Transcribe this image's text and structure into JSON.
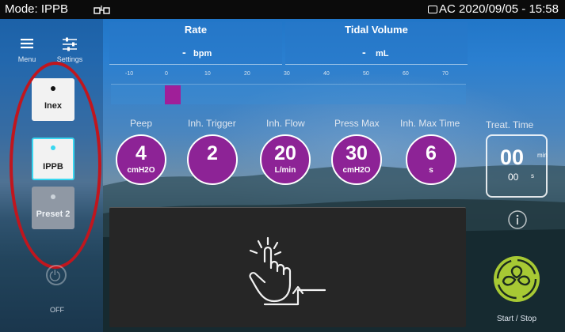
{
  "status_bar": {
    "mode": "Mode: IPPB",
    "datetime": "AC 2020/09/05 - 15:58"
  },
  "left_rail": {
    "menu_label": "Menu",
    "settings_label": "Settings",
    "modes": [
      {
        "label": "Inex",
        "selected": false
      },
      {
        "label": "IPPB",
        "selected": true
      },
      {
        "label": "Preset 2",
        "selected": false
      }
    ],
    "off_label": "OFF"
  },
  "readouts": {
    "rate": {
      "title": "Rate",
      "value": "-",
      "unit": "bpm"
    },
    "tidal_volume": {
      "title": "Tidal Volume",
      "value": "-",
      "unit": "mL"
    }
  },
  "pressure_bar": {
    "scale": [
      "-10",
      "0",
      "10",
      "20",
      "30",
      "40",
      "50",
      "60",
      "70"
    ],
    "marker_value": 2
  },
  "parameters": [
    {
      "label": "Peep",
      "value": "4",
      "unit": "cmH2O"
    },
    {
      "label": "Inh. Trigger",
      "value": "2",
      "unit": ""
    },
    {
      "label": "Inh. Flow",
      "value": "20",
      "unit": "L/min"
    },
    {
      "label": "Press Max",
      "value": "30",
      "unit": "cmH2O"
    },
    {
      "label": "Inh. Max Time",
      "value": "6",
      "unit": "s"
    }
  ],
  "treat_time": {
    "label": "Treat. Time",
    "minutes": "00",
    "seconds": "00",
    "minutes_unit": "min",
    "seconds_unit": "s"
  },
  "start_stop_label": "Start / Stop",
  "colors": {
    "param_circle": "#8d2396",
    "marker": "#a01f99",
    "highlight_ring": "#c0161e",
    "start_button": "#a7c934",
    "selected_mode_border": "#39d7f0"
  },
  "icons": {
    "menu": "hamburger-icon",
    "settings": "sliders-icon",
    "power": "power-icon",
    "info": "info-icon",
    "trigger": "hand-tap-icon",
    "start": "fan-icon"
  }
}
